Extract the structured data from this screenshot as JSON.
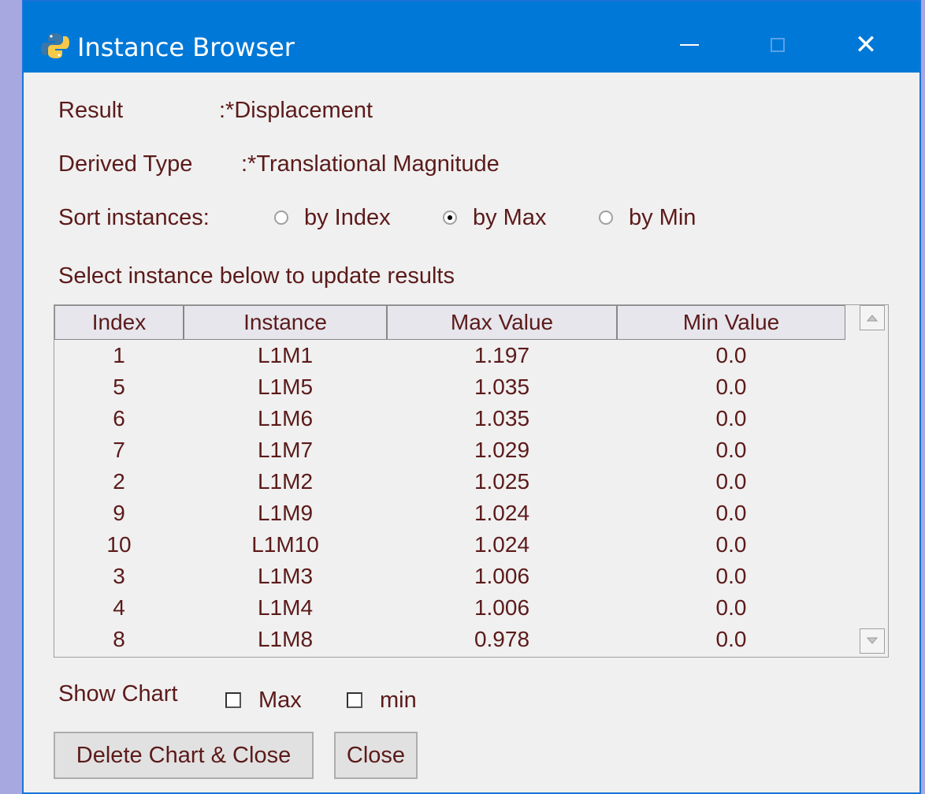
{
  "window": {
    "title": "Instance Browser",
    "accent": "#0078d7",
    "text_color": "#5c1a1a"
  },
  "result": {
    "label": "Result",
    "value": ":*Displacement"
  },
  "derived_type": {
    "label": "Derived Type",
    "value": ":*Translational Magnitude"
  },
  "sort": {
    "label": "Sort instances:",
    "options": [
      {
        "label": "by Index",
        "checked": false
      },
      {
        "label": "by Max",
        "checked": true
      },
      {
        "label": "by Min",
        "checked": false
      }
    ]
  },
  "select_hint": "Select instance below to update results",
  "table": {
    "columns": [
      "Index",
      "Instance",
      "Max Value",
      "Min Value"
    ],
    "rows": [
      [
        "1",
        "L1M1",
        "1.197",
        "0.0"
      ],
      [
        "5",
        "L1M5",
        "1.035",
        "0.0"
      ],
      [
        "6",
        "L1M6",
        "1.035",
        "0.0"
      ],
      [
        "7",
        "L1M7",
        "1.029",
        "0.0"
      ],
      [
        "2",
        "L1M2",
        "1.025",
        "0.0"
      ],
      [
        "9",
        "L1M9",
        "1.024",
        "0.0"
      ],
      [
        "10",
        "L1M10",
        "1.024",
        "0.0"
      ],
      [
        "3",
        "L1M3",
        "1.006",
        "0.0"
      ],
      [
        "4",
        "L1M4",
        "1.006",
        "0.0"
      ],
      [
        "8",
        "L1M8",
        "0.978",
        "0.0"
      ]
    ]
  },
  "show_chart": {
    "label": "Show Chart",
    "max_label": "Max",
    "min_label": "min",
    "max_checked": false,
    "min_checked": false
  },
  "buttons": {
    "delete_close": "Delete Chart & Close",
    "close": "Close"
  }
}
